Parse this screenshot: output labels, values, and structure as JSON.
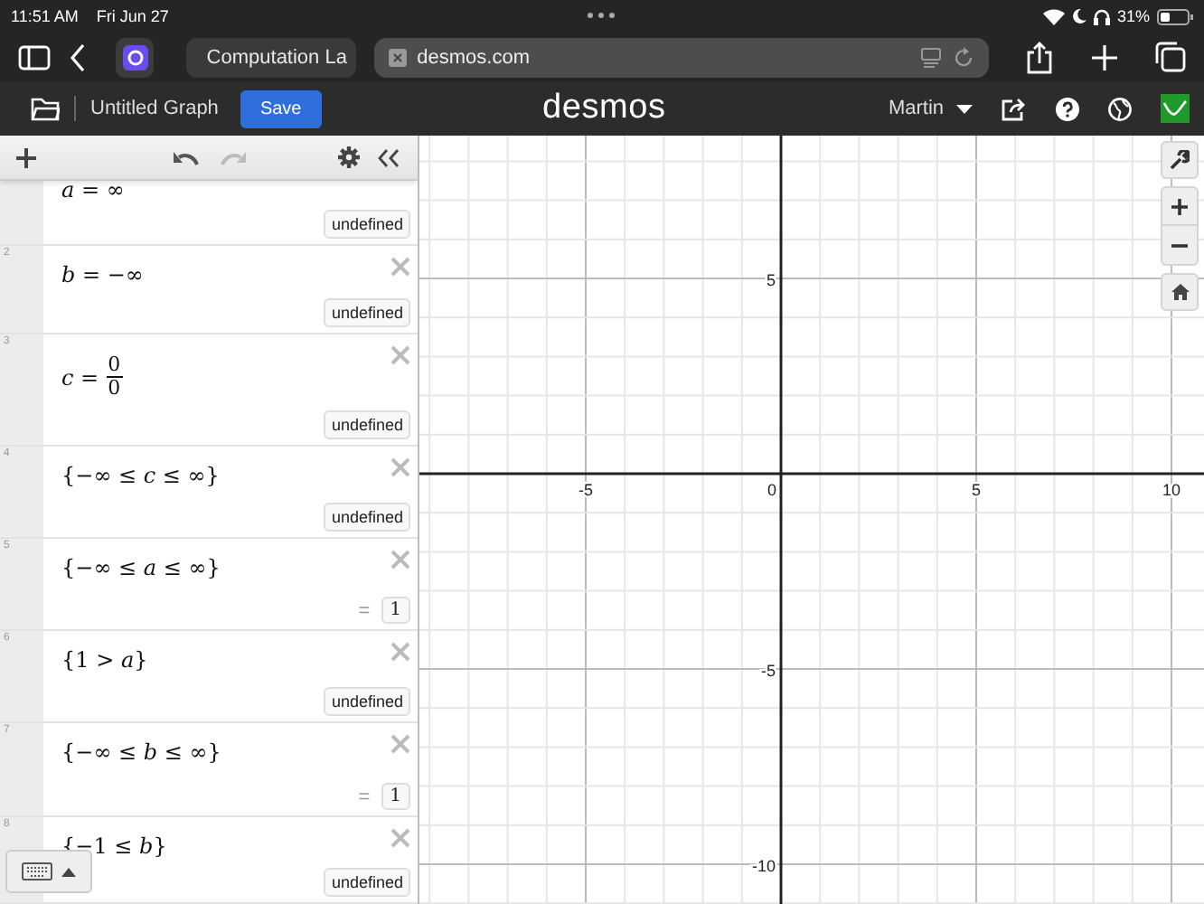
{
  "status_bar": {
    "time": "11:51 AM",
    "date": "Fri Jun 27",
    "battery": "31%"
  },
  "browser": {
    "tab_title": "Computation La",
    "url": "desmos.com"
  },
  "header": {
    "title": "Untitled Graph",
    "save_button": "Save",
    "logo": "desmos",
    "user": "Martin"
  },
  "expressions": [
    {
      "kind": "text",
      "math": "*a* = ∞",
      "result": {
        "kind": "badge",
        "text": "undefined"
      }
    },
    {
      "kind": "text",
      "number": "2",
      "math": "*b* = −∞",
      "result": {
        "kind": "badge",
        "text": "undefined"
      }
    },
    {
      "kind": "fraction",
      "number": "3",
      "lhs": "*c* =",
      "numerator": "0",
      "denominator": "0",
      "result": {
        "kind": "badge",
        "text": "undefined"
      }
    },
    {
      "kind": "text",
      "number": "4",
      "math": "{−∞ ≤ *c* ≤ ∞}",
      "result": {
        "kind": "badge",
        "text": "undefined"
      }
    },
    {
      "kind": "text",
      "number": "5",
      "math": "{−∞ ≤ *a* ≤ ∞}",
      "result": {
        "kind": "equals",
        "sign": "=",
        "text": "1"
      }
    },
    {
      "kind": "text",
      "number": "6",
      "math": "{1 > *a*}",
      "result": {
        "kind": "badge",
        "text": "undefined"
      }
    },
    {
      "kind": "text",
      "number": "7",
      "math": "{−∞ ≤ *b* ≤ ∞}",
      "result": {
        "kind": "equals",
        "sign": "=",
        "text": "1"
      }
    },
    {
      "kind": "text",
      "number": "8",
      "math": "{−1 ≤ *b*}",
      "result": {
        "kind": "badge",
        "text": "undefined"
      }
    }
  ],
  "graph": {
    "x_labels": [
      "-5",
      "0",
      "5",
      "10"
    ],
    "y_labels": [
      "5",
      "-5",
      "-10"
    ]
  }
}
